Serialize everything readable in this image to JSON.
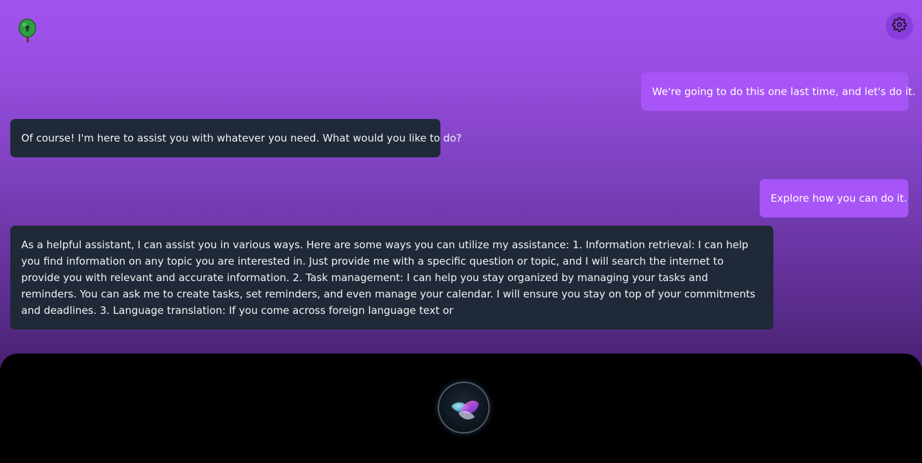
{
  "header": {
    "logo_icon": "tree-logo-icon",
    "settings_icon": "gear-icon"
  },
  "messages": [
    {
      "role": "user",
      "text": "We're going to do this one last time, and let's do it."
    },
    {
      "role": "assistant",
      "text": "Of course! I'm here to assist you with whatever you need. What would you like to do?"
    },
    {
      "role": "user",
      "text": "Explore how you can do it."
    },
    {
      "role": "assistant",
      "text": "As a helpful assistant, I can assist you in various ways. Here are some ways you can utilize my assistance: 1. Information retrieval: I can help you find information on any topic you are interested in. Just provide me with a specific question or topic, and I will search the internet to provide you with relevant and accurate information. 2. Task management: I can help you stay organized by managing your tasks and reminders. You can ask me to create tasks, set reminders, and even manage your calendar. I will ensure you stay on top of your commitments and deadlines. 3. Language translation: If you come across foreign language text or"
    }
  ],
  "footer": {
    "voice_icon": "assistant-orb-icon"
  },
  "colors": {
    "user_bubble": "#a855f7",
    "assistant_bubble": "#1f2937",
    "settings_bg": "#8a3ddd"
  }
}
